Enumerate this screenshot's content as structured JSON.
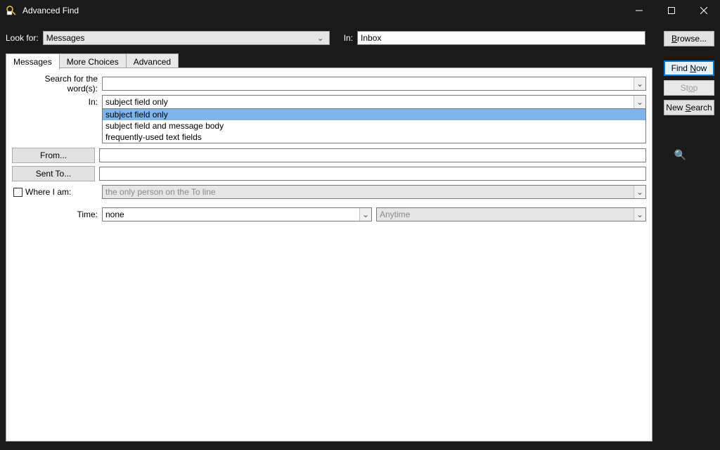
{
  "window": {
    "title": "Advanced Find"
  },
  "top": {
    "look_for_label": "Look for:",
    "look_for_value": "Messages",
    "in_label": "In:",
    "in_value": "Inbox",
    "browse": "Browse..."
  },
  "buttons": {
    "find_now": "Find Now",
    "stop": "Stop",
    "new_search": "New Search"
  },
  "tabs": {
    "messages": "Messages",
    "more_choices": "More Choices",
    "advanced": "Advanced"
  },
  "form": {
    "search_words_label": "Search for the word(s):",
    "in_label": "In:",
    "in_value": "subject field only",
    "from": "From...",
    "sent_to": "Sent To...",
    "where_label": "Where I am:",
    "where_value": "the only person on the To line",
    "time_label": "Time:",
    "time_value": "none",
    "time_range": "Anytime"
  },
  "dropdown": {
    "opt1": "subject field only",
    "opt2": "subject field and message body",
    "opt3": "frequently-used text fields"
  },
  "underline": {
    "B": "B",
    "N": "N",
    "S": "S",
    "o": "o",
    "W": "W"
  }
}
